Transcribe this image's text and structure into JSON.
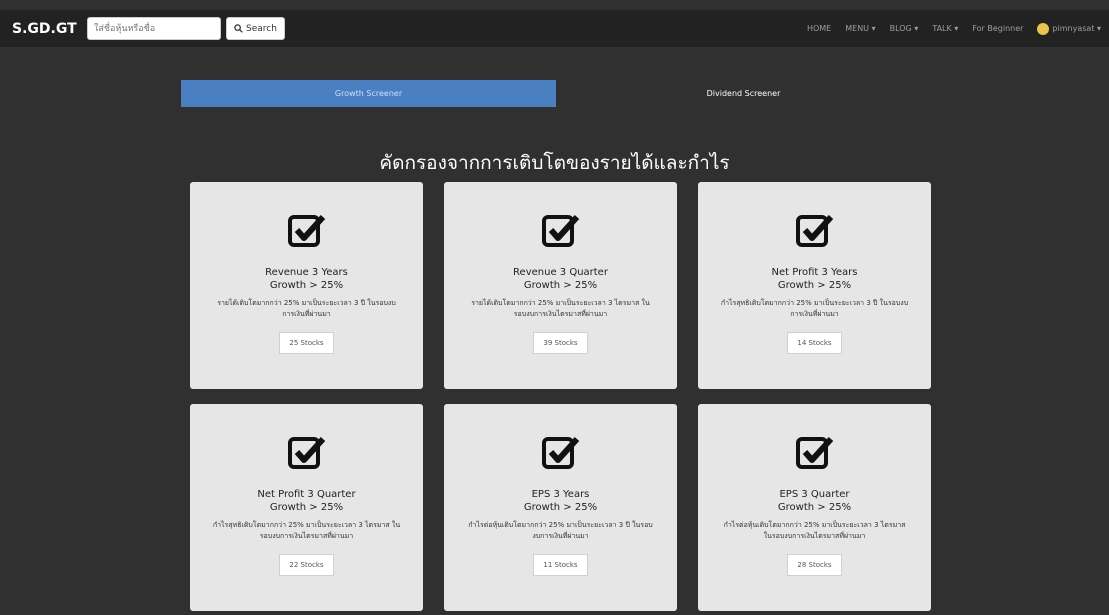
{
  "navbar": {
    "brand": "S.GD.GT",
    "search_placeholder": "ใส่ชื่อหุ้นหรือชื่อ",
    "search_label": "Search",
    "nav_items": [
      "HOME",
      "MENU ▾",
      "BLOG ▾",
      "TALK ▾",
      "For Beginner"
    ],
    "user_label": "pimnyasat ▾"
  },
  "tabs": [
    {
      "label": "Growth Screener",
      "active": true
    },
    {
      "label": "Dividend Screener",
      "active": false
    }
  ],
  "heading": "คัดกรองจากการเติบโตของรายได้และกำไร",
  "cards": [
    {
      "title_line1": "Revenue 3 Years",
      "title_line2": "Growth > 25%",
      "desc": "รายได้เติบโตมากกว่า 25% มาเป็นระยะเวลา 3 ปี ในรอบงบการเงินที่ผ่านมา",
      "button": "25 Stocks"
    },
    {
      "title_line1": "Revenue 3 Quarter",
      "title_line2": "Growth > 25%",
      "desc": "รายได้เติบโตมากกว่า 25% มาเป็นระยะเวลา 3 ไตรมาส ในรอบงบการเงินไตรมาสที่ผ่านมา",
      "button": "39 Stocks"
    },
    {
      "title_line1": "Net Profit 3 Years",
      "title_line2": "Growth > 25%",
      "desc": "กำไรสุทธิเติบโตมากกว่า 25% มาเป็นระยะเวลา 3 ปี ในรอบงบการเงินที่ผ่านมา",
      "button": "14 Stocks"
    },
    {
      "title_line1": "Net Profit 3 Quarter",
      "title_line2": "Growth > 25%",
      "desc": "กำไรสุทธิเติบโตมากกว่า 25% มาเป็นระยะเวลา 3 ไตรมาส ในรอบงบการเงินไตรมาสที่ผ่านมา",
      "button": "22 Stocks"
    },
    {
      "title_line1": "EPS 3 Years",
      "title_line2": "Growth > 25%",
      "desc": "กำไรต่อหุ้นเติบโตมากกว่า 25% มาเป็นระยะเวลา 3 ปี ในรอบงบการเงินที่ผ่านมา",
      "button": "11 Stocks"
    },
    {
      "title_line1": "EPS 3 Quarter",
      "title_line2": "Growth > 25%",
      "desc": "กำไรต่อหุ้นเติบโตมากกว่า 25% มาเป็นระยะเวลา 3 ไตรมาส ในรอบงบการเงินไตรมาสที่ผ่านมา",
      "button": "28 Stocks"
    }
  ]
}
